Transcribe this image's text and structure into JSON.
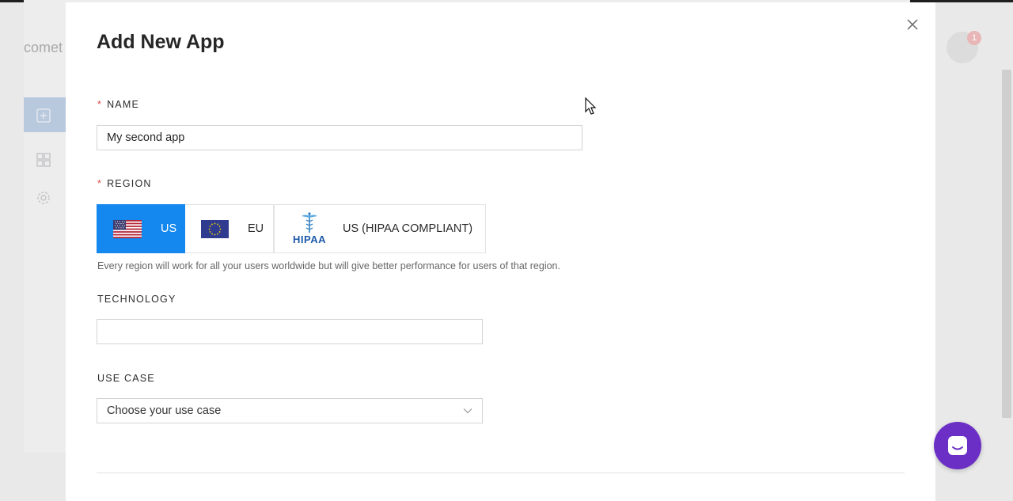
{
  "background_app": {
    "logo_text": "comet",
    "notification_count": "1"
  },
  "modal": {
    "title": "Add New App",
    "close_icon": "close-icon"
  },
  "form": {
    "name": {
      "label": "NAME",
      "required_mark": "*",
      "value": "My second app",
      "placeholder": ""
    },
    "region": {
      "label": "REGION",
      "required_mark": "*",
      "options": [
        {
          "label": "US",
          "icon": "us-flag-icon",
          "selected": true
        },
        {
          "label": "EU",
          "icon": "eu-flag-icon",
          "selected": false
        },
        {
          "label": "US (HIPAA COMPLIANT)",
          "icon": "hipaa-logo",
          "logo_text": "HIPAA",
          "selected": false
        }
      ],
      "help_text": "Every region will work for all your users worldwide but will give better performance for users of that region."
    },
    "technology": {
      "label": "TECHNOLOGY",
      "value": ""
    },
    "use_case": {
      "label": "USE CASE",
      "selected_value": "Choose your use case",
      "chevron_icon": "chevron-down-icon"
    }
  },
  "colors": {
    "accent": "#1588f0",
    "required": "#e5484d",
    "chat_button": "#6b2fc5"
  }
}
